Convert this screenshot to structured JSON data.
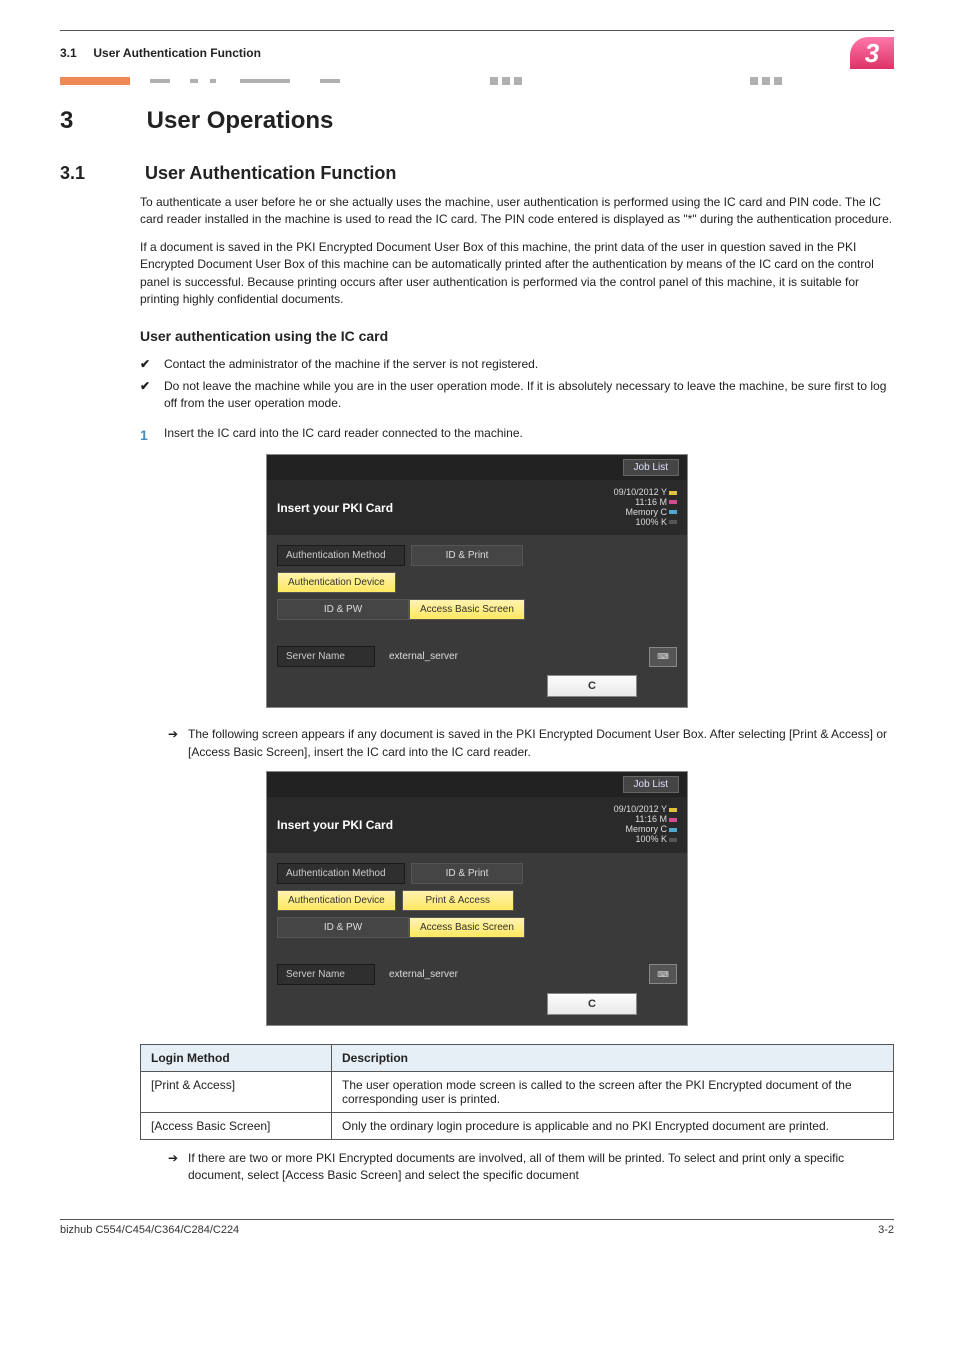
{
  "header": {
    "section_ref": "3.1",
    "section_title_short": "User Authentication Function",
    "chapter_badge": "3"
  },
  "chapter": {
    "num": "3",
    "title": "User Operations"
  },
  "section": {
    "num": "3.1",
    "title": "User Authentication Function"
  },
  "paras": {
    "p1": "To authenticate a user before he or she actually uses the machine, user authentication is performed using the IC card and PIN code. The IC card reader installed in the machine is used to read the IC card. The PIN code entered is displayed as \"*\" during the authentication procedure.",
    "p2": "If a document is saved in the PKI Encrypted Document User Box of this machine, the print data of the user in question saved in the PKI Encrypted Document User Box of this machine can be automatically printed after the authentication by means of the IC card on the control panel is successful. Because printing occurs after user authentication is performed via the control panel of this machine, it is suitable for printing highly confidential documents."
  },
  "subsection": {
    "title": "User authentication using the IC card"
  },
  "checks": {
    "c1": "Contact the administrator of the machine if the server is not registered.",
    "c2": "Do not leave the machine while you are in the user operation mode. If it is absolutely necessary to leave the machine, be sure first to log off from the user operation mode."
  },
  "steps": {
    "s1_num": "1",
    "s1_text": "Insert the IC card into the IC card reader connected to the machine."
  },
  "arrows": {
    "a1": "The following screen appears if any document is saved in the PKI Encrypted Document User Box. After selecting [Print & Access] or [Access Basic Screen], insert the IC card into the IC card reader.",
    "a2": "If there are two or more PKI Encrypted documents are involved, all of them will be printed. To select and print only a specific document, select [Access Basic Screen] and select the specific document"
  },
  "screen_common": {
    "job_list": "Job List",
    "title": "Insert your PKI Card",
    "date": "09/10/2012",
    "time": "11:16",
    "memory_label": "Memory",
    "memory_value": "100%",
    "auth_method": "Authentication Method",
    "auth_device": "Authentication Device",
    "id_pw": "ID & PW",
    "id_print": "ID & Print",
    "print_access": "Print & Access",
    "access_basic": "Access Basic Screen",
    "server_name_label": "Server Name",
    "server_value": "external_server",
    "c_button": "C"
  },
  "table": {
    "headers": {
      "method": "Login Method",
      "desc": "Description"
    },
    "rows": [
      {
        "method": "[Print & Access]",
        "desc": "The user operation mode screen is called to the screen after the PKI Encrypted document of the corresponding user is printed."
      },
      {
        "method": "[Access Basic Screen]",
        "desc": "Only the ordinary login procedure is applicable and no PKI Encrypted document are printed."
      }
    ]
  },
  "footer": {
    "model": "bizhub C554/C454/C364/C284/C224",
    "page": "3-2"
  }
}
